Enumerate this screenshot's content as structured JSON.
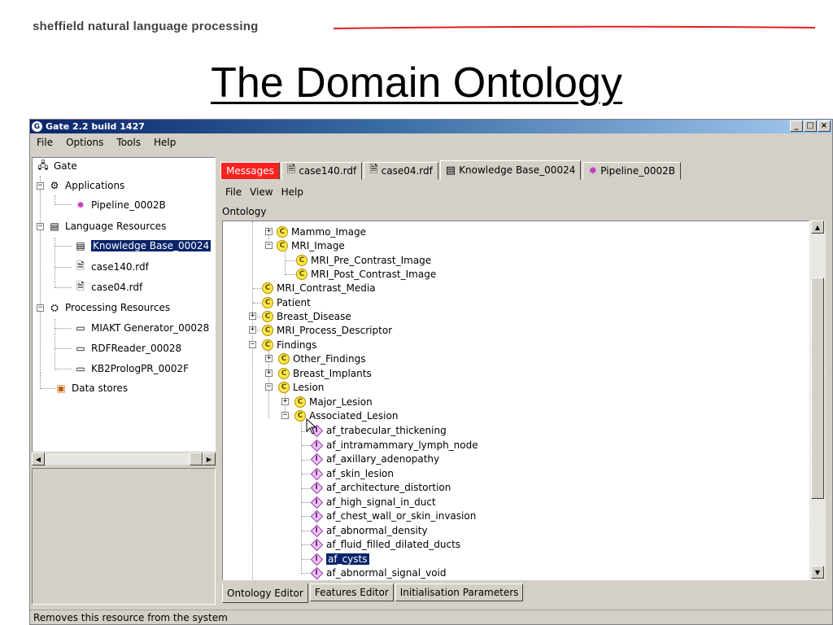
{
  "slide": {
    "brand": "sheffield natural language processing",
    "title": "The Domain Ontology"
  },
  "window": {
    "title": "Gate 2.2 build 1427",
    "menu": [
      "File",
      "Options",
      "Tools",
      "Help"
    ],
    "status": "Removes this resource from the system"
  },
  "left_tree": {
    "root": "Gate",
    "applications": "Applications",
    "pipeline": "Pipeline_0002B",
    "language_resources": "Language Resources",
    "kb": "Knowledge Base_00024",
    "case140": "case140.rdf",
    "case04": "case04.rdf",
    "processing_resources": "Processing Resources",
    "miakt": "MIAKT Generator_00028",
    "rdfreader": "RDFReader_00028",
    "kb2prolog": "KB2PrologPR_0002F",
    "datastores": "Data stores"
  },
  "tabs": {
    "messages": "Messages",
    "case140": "case140.rdf",
    "case04": "case04.rdf",
    "kb": "Knowledge Base_00024",
    "pipeline": "Pipeline_0002B"
  },
  "inner_menu": [
    "File",
    "View",
    "Help"
  ],
  "ontology_label": "Ontology",
  "ontology": {
    "mammo": "Mammo_Image",
    "mri": "MRI_Image",
    "mri_pre": "MRI_Pre_Contrast_Image",
    "mri_post": "MRI_Post_Contrast_Image",
    "mri_media": "MRI_Contrast_Media",
    "patient": "Patient",
    "breast_disease": "Breast_Disease",
    "mri_process": "MRI_Process_Descriptor",
    "findings": "Findings",
    "other_findings": "Other_Findings",
    "breast_implants": "Breast_Implants",
    "lesion": "Lesion",
    "major_lesion": "Major_Lesion",
    "associated_lesion": "Associated_Lesion",
    "instances": [
      "af_trabecular_thickening",
      "af_intramammary_lymph_node",
      "af_axillary_adenopathy",
      "af_skin_lesion",
      "af_architecture_distortion",
      "af_high_signal_in_duct",
      "af_chest_wall_or_skin_invasion",
      "af_abnormal_density",
      "af_fluid_filled_dilated_ducts",
      "af_cysts",
      "af_abnormal_signal_void"
    ]
  },
  "bottom_tabs": {
    "ontology_editor": "Ontology Editor",
    "features_editor": "Features Editor",
    "init_params": "Initialisation Parameters"
  },
  "icons": {
    "class": "C",
    "instance": "I",
    "gate": "G"
  },
  "colors": {
    "messages_tab": "#ff2020",
    "selection": "#0a246a",
    "brand_line": "#e02020"
  }
}
